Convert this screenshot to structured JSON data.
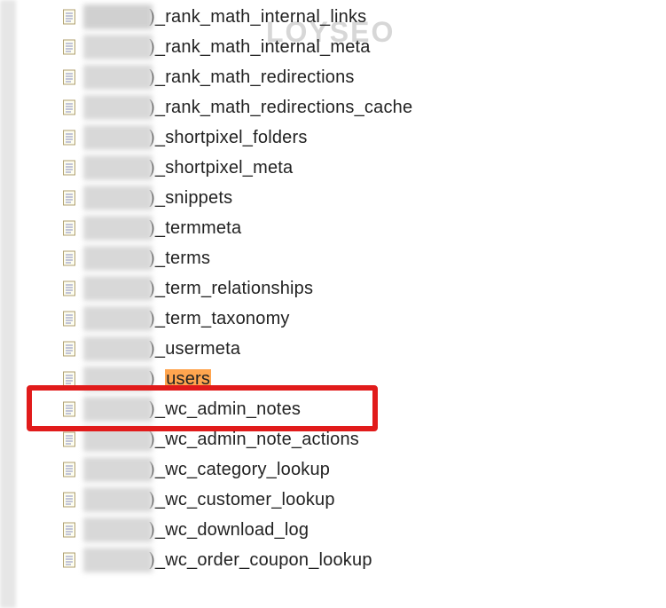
{
  "watermark": "LOYSEO",
  "prefix_piece": ")",
  "highlight_row_index": 13,
  "highlight_text": "users",
  "tables": [
    {
      "suffix": "_rank_math_internal_links"
    },
    {
      "suffix": "_rank_math_internal_meta"
    },
    {
      "suffix": "_rank_math_redirections"
    },
    {
      "suffix": "_rank_math_redirections_cache"
    },
    {
      "suffix": "_shortpixel_folders"
    },
    {
      "suffix": "_shortpixel_meta"
    },
    {
      "suffix": "_snippets"
    },
    {
      "suffix": "_termmeta"
    },
    {
      "suffix": "_terms"
    },
    {
      "suffix": "_term_relationships"
    },
    {
      "suffix": "_term_taxonomy"
    },
    {
      "suffix": "_usermeta"
    },
    {
      "suffix": "_users",
      "highlight": "users",
      "pre": "_"
    },
    {
      "suffix": "_wc_admin_notes"
    },
    {
      "suffix": "_wc_admin_note_actions"
    },
    {
      "suffix": "_wc_category_lookup"
    },
    {
      "suffix": "_wc_customer_lookup"
    },
    {
      "suffix": "_wc_download_log"
    },
    {
      "suffix": "_wc_order_coupon_lookup"
    }
  ]
}
